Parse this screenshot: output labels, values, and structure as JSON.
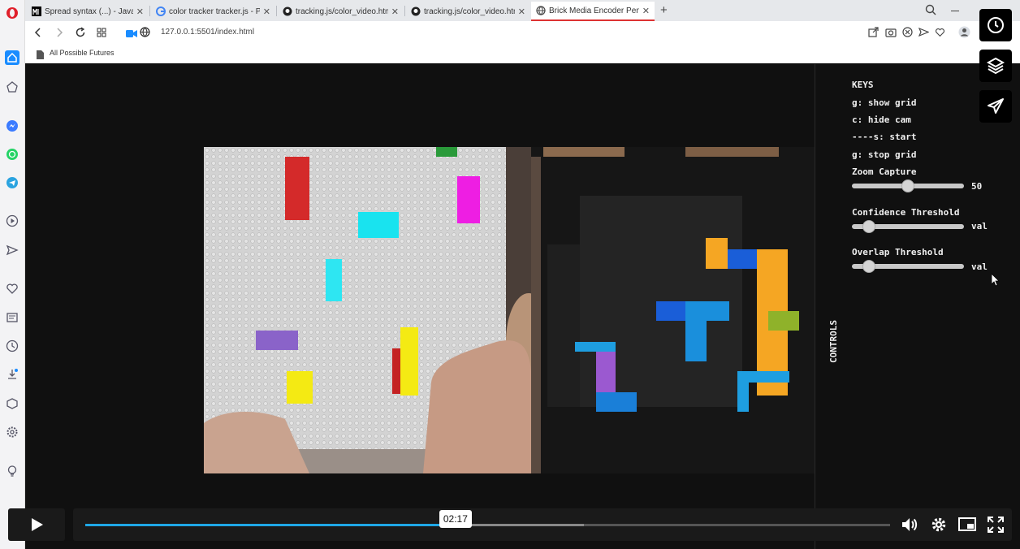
{
  "tabs": [
    {
      "label": "Spread syntax (...) - JavaScr",
      "favicon": "mdn-icon",
      "active": false
    },
    {
      "label": "color tracker tracker.js - Pe",
      "favicon": "google-icon",
      "active": false
    },
    {
      "label": "tracking.js/color_video.htm",
      "favicon": "github-icon",
      "active": false
    },
    {
      "label": "tracking.js/color_video.htm",
      "favicon": "github-icon",
      "active": false
    },
    {
      "label": "Brick Media Encoder Penc",
      "favicon": "globe-icon",
      "active": true
    }
  ],
  "toolbar": {
    "url": "127.0.0.1:5501/index.html"
  },
  "bookmarks": {
    "item_label": "All Possible Futures"
  },
  "controls": {
    "keys_title": "KEYS",
    "keys": [
      "g: show grid",
      "c: hide cam",
      "----s: start",
      "g: stop grid"
    ],
    "zoom_label": "Zoom Capture",
    "zoom_value": "50",
    "zoom_level": 0.5,
    "confidence_label": "Confidence Threshold",
    "confidence_value": "val",
    "confidence_level": 0.15,
    "overlap_label": "Overlap Threshold",
    "overlap_value": "val",
    "overlap_level": 0.15,
    "tab_label": "CONTROLS"
  },
  "video": {
    "time_tooltip": "02:17",
    "played_fraction": 0.46,
    "buffered_fraction": 0.62
  },
  "colors": {
    "accent_blue": "#1fa7e6",
    "active_tab_underline": "#dd3333",
    "brick_red": "#d42a2a",
    "brick_cyan": "#19e3ef",
    "brick_magenta": "#ee1ee3",
    "brick_yellow": "#f4ea13",
    "brick_purple": "#8a63c9",
    "brick_orange": "#f5a623",
    "brick_blue": "#1a5ed8",
    "brick_lightblue": "#1e9ee0",
    "brick_green": "#8fb22a"
  }
}
